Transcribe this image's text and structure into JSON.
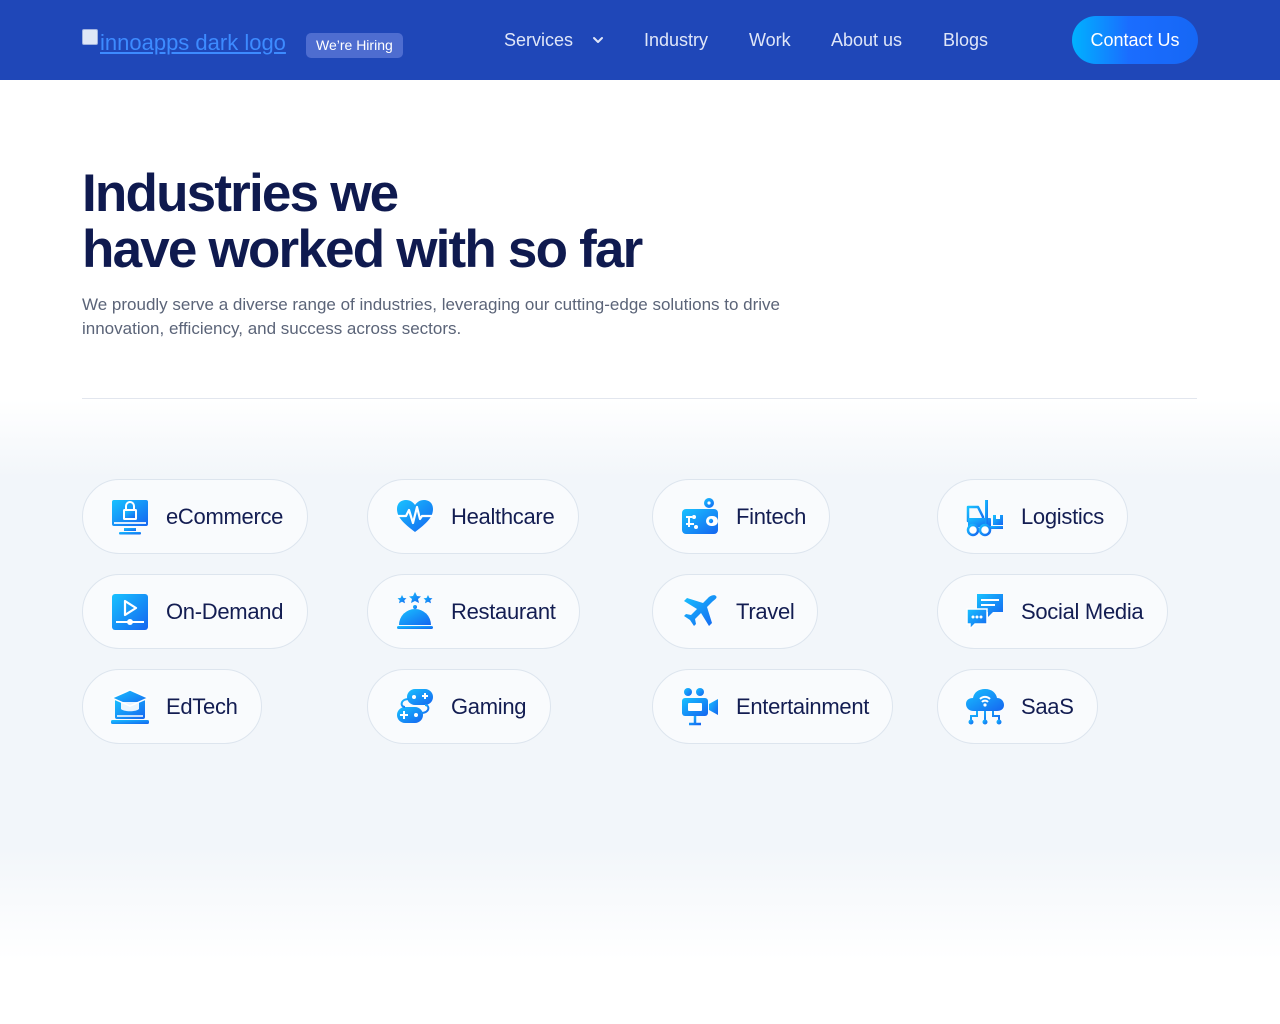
{
  "header": {
    "logo_alt": "innoapps dark logo",
    "hiring_badge": "We’re Hiring",
    "nav": {
      "services": "Services",
      "industry": "Industry",
      "work": "Work",
      "about": "About us",
      "blogs": "Blogs"
    },
    "contact_label": "Contact Us"
  },
  "hero": {
    "title_line1": "Industries we",
    "title_line2": "have worked with so far",
    "description": "We proudly serve a diverse range of industries, leveraging our cutting-edge solutions to drive innovation, efficiency, and success across sectors."
  },
  "industries": [
    {
      "label": "eCommerce",
      "icon": "ecommerce-icon"
    },
    {
      "label": "Healthcare",
      "icon": "healthcare-icon"
    },
    {
      "label": "Fintech",
      "icon": "fintech-icon"
    },
    {
      "label": "Logistics",
      "icon": "logistics-icon"
    },
    {
      "label": "On-Demand",
      "icon": "on-demand-icon"
    },
    {
      "label": "Restaurant",
      "icon": "restaurant-icon"
    },
    {
      "label": "Travel",
      "icon": "travel-icon"
    },
    {
      "label": "Social Media",
      "icon": "social-media-icon"
    },
    {
      "label": "EdTech",
      "icon": "edtech-icon"
    },
    {
      "label": "Gaming",
      "icon": "gaming-icon"
    },
    {
      "label": "Entertainment",
      "icon": "entertainment-icon"
    },
    {
      "label": "SaaS",
      "icon": "saas-icon"
    }
  ],
  "colors": {
    "header_bg": "#1f47b8",
    "title": "#0f1a4f",
    "accent_start": "#00b2ff",
    "accent_end": "#1667f5"
  }
}
